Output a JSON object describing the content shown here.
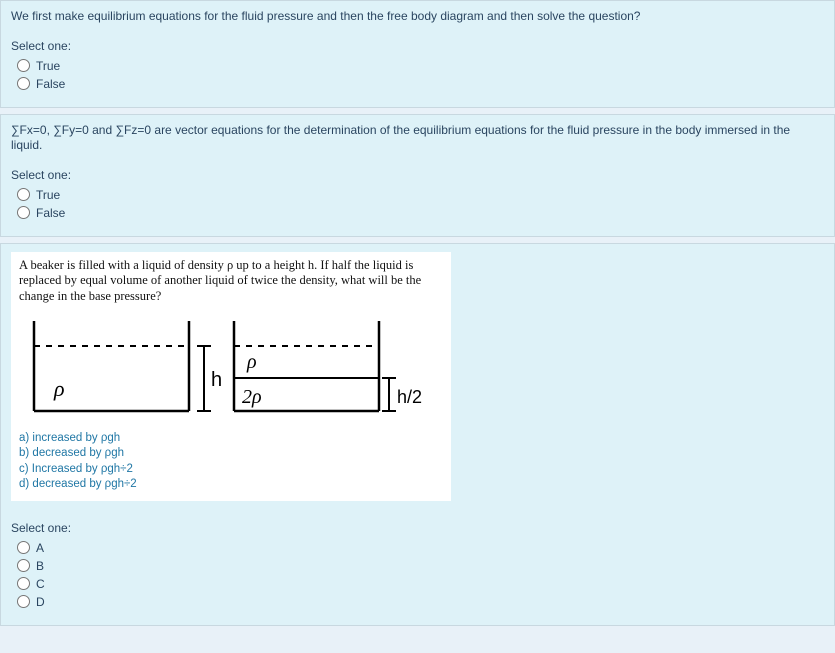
{
  "q1": {
    "text": "We first make equilibrium equations for the fluid pressure and then the free body diagram and then solve the question?",
    "select": "Select one:",
    "opts": [
      "True",
      "False"
    ]
  },
  "q2": {
    "text": "∑Fx=0, ∑Fy=0 and ∑Fz=0 are vector equations for the determination of the equilibrium equations for the fluid pressure in the body immersed in the liquid.",
    "select": "Select one:",
    "opts": [
      "True",
      "False"
    ]
  },
  "q3": {
    "imgtext": "A beaker is filled with a liquid of density ρ up to a height h. If half the liquid is replaced by equal volume of another liquid of twice the density, what will be the change in the base pressure?",
    "labels": {
      "rho": "ρ",
      "tworho": "2ρ",
      "h": "h",
      "h2": "h/2"
    },
    "answers": [
      "a) increased by ρgh",
      "b) decreased by ρgh",
      "c) Increased by ρgh÷2",
      "d) decreased by ρgh÷2"
    ],
    "select": "Select one:",
    "opts": [
      "A",
      "B",
      "C",
      "D"
    ]
  }
}
